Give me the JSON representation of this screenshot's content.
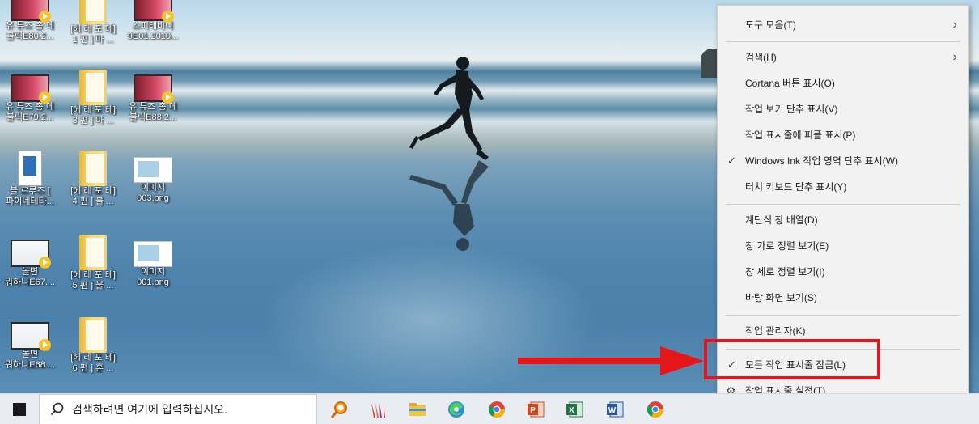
{
  "desktop": {
    "icons": [
      {
        "line1": "유 튜즈 총 데",
        "line2": "블릭E80.2...",
        "kind": "video"
      },
      {
        "line1": "[헤 레 포 테]",
        "line2": "1 편 ] 마 ...",
        "kind": "folder"
      },
      {
        "line1": "스피테비니",
        "line2": "9E01.2010...",
        "kind": "video"
      },
      {
        "line1": "유 튜즈 총 데",
        "line2": "블릭E79.2...",
        "kind": "video"
      },
      {
        "line1": "[헤 레 포 테]",
        "line2": "3 편 ] 아 ...",
        "kind": "folder"
      },
      {
        "line1": "유 튜즈 총 데",
        "line2": "블릭E88.2...",
        "kind": "video"
      },
      {
        "line1": "블 르루즈 [",
        "line2": "파이네테타...",
        "kind": "script"
      },
      {
        "line1": "[헤 레 포 테]",
        "line2": "4 편 ] 불 ...",
        "kind": "folder"
      },
      {
        "line1": "이미지",
        "line2": "003.png",
        "kind": "image"
      },
      {
        "line1": "놀면",
        "line2": "뭐하니E67....",
        "kind": "video-white"
      },
      {
        "line1": "[헤 레 포 테]",
        "line2": "5 편 ] 불 ...",
        "kind": "folder"
      },
      {
        "line1": "이미지",
        "line2": "001.png",
        "kind": "image"
      },
      {
        "line1": "놀면",
        "line2": "뭐하니E68....",
        "kind": "video-white"
      },
      {
        "line1": "[헤 레 포 테]",
        "line2": "6 편 ] 혼 ...",
        "kind": "folder"
      }
    ]
  },
  "context_menu": {
    "items": [
      {
        "label": "도구 모음(T)",
        "submenu": true,
        "checked": false
      },
      {
        "label": "검색(H)",
        "submenu": true,
        "checked": false
      },
      {
        "label": "Cortana 버튼 표시(O)",
        "submenu": false,
        "checked": false
      },
      {
        "label": "작업 보기 단추 표시(V)",
        "submenu": false,
        "checked": false
      },
      {
        "label": "작업 표시줄에 피플 표시(P)",
        "submenu": false,
        "checked": false
      },
      {
        "label": "Windows Ink 작업 영역 단추 표시(W)",
        "submenu": false,
        "checked": true
      },
      {
        "label": "터치 키보드 단추 표시(Y)",
        "submenu": false,
        "checked": false
      },
      {
        "label": "계단식 창 배열(D)",
        "submenu": false,
        "checked": false
      },
      {
        "label": "창 가로 정렬 보기(E)",
        "submenu": false,
        "checked": false
      },
      {
        "label": "창 세로 정렬 보기(I)",
        "submenu": false,
        "checked": false
      },
      {
        "label": "바탕 화면 보기(S)",
        "submenu": false,
        "checked": false
      },
      {
        "label": "작업 관리자(K)",
        "submenu": false,
        "checked": false
      },
      {
        "label": "모든 작업 표시줄 잠금(L)",
        "submenu": false,
        "checked": true
      },
      {
        "label": "작업 표시줄 설정(T)",
        "submenu": false,
        "checked": false,
        "icon": "gear-icon"
      }
    ],
    "check_glyph": "✓",
    "arrow_glyph": "›",
    "highlight_color": "#e4161a"
  },
  "taskbar": {
    "search_placeholder": "검색하려면 여기에 입력하십시오.",
    "apps": [
      "search-app-icon",
      "brush-app-icon",
      "file-explorer-icon",
      "edge-icon",
      "chrome-icon",
      "powerpoint-icon",
      "excel-icon",
      "word-icon",
      "chrome-icon"
    ]
  }
}
